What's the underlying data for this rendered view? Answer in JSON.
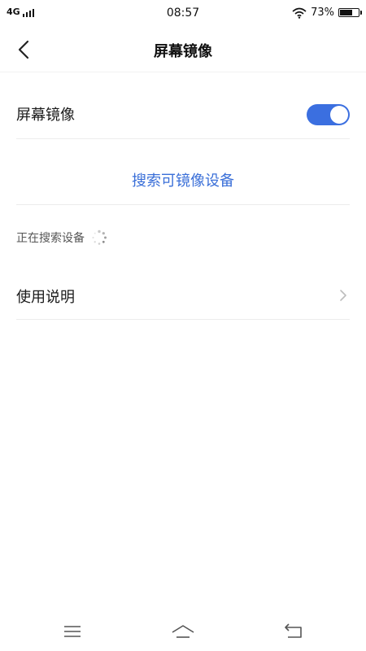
{
  "status_bar": {
    "network": "4G",
    "time": "08:57",
    "battery_percent": "73%",
    "battery_level": 0.73,
    "icons": [
      "signal-icon",
      "wifi-icon",
      "battery-icon"
    ]
  },
  "header": {
    "title": "屏幕镜像",
    "back_icon": "back-arrow-icon"
  },
  "settings": {
    "screen_mirror": {
      "label": "屏幕镜像",
      "enabled": true
    },
    "search_button_label": "搜索可镜像设备",
    "searching_text": "正在搜索设备",
    "instructions": {
      "label": "使用说明",
      "icon": "chevron-right-icon"
    }
  },
  "bottom_nav": {
    "icons": [
      "menu-icon",
      "home-icon",
      "back-icon"
    ]
  },
  "colors": {
    "accent": "#3b6fe0",
    "link": "#3a6fd8",
    "divider": "#ececec"
  }
}
